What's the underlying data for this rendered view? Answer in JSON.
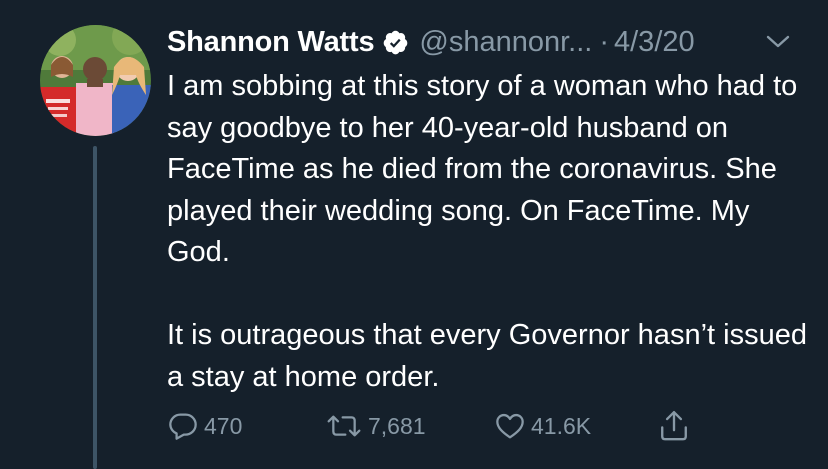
{
  "tweet": {
    "author": {
      "name": "Shannon Watts",
      "handle": "@shannonr...",
      "separator": "·",
      "date": "4/3/20",
      "verified": true
    },
    "text": {
      "paragraph_1": "I am sobbing at this story of a woman who had to say goodbye to her 40-year-old husband on FaceTime as he died from the coronavirus. She played their wedding song. On FaceTime. My God.",
      "paragraph_2": "It is outrageous that every Governor hasn’t issued a stay at home order."
    },
    "stats": {
      "replies": "470",
      "retweets": "7,681",
      "likes": "41.6K"
    }
  },
  "icons": {
    "verified": "verified-badge-icon",
    "more": "chevron-down-icon",
    "reply": "reply-icon",
    "retweet": "retweet-icon",
    "like": "heart-icon",
    "share": "share-icon"
  },
  "colors": {
    "background": "#15202b",
    "text_primary": "#ffffff",
    "text_secondary": "#8899a6",
    "thread_line": "#3d5466"
  }
}
